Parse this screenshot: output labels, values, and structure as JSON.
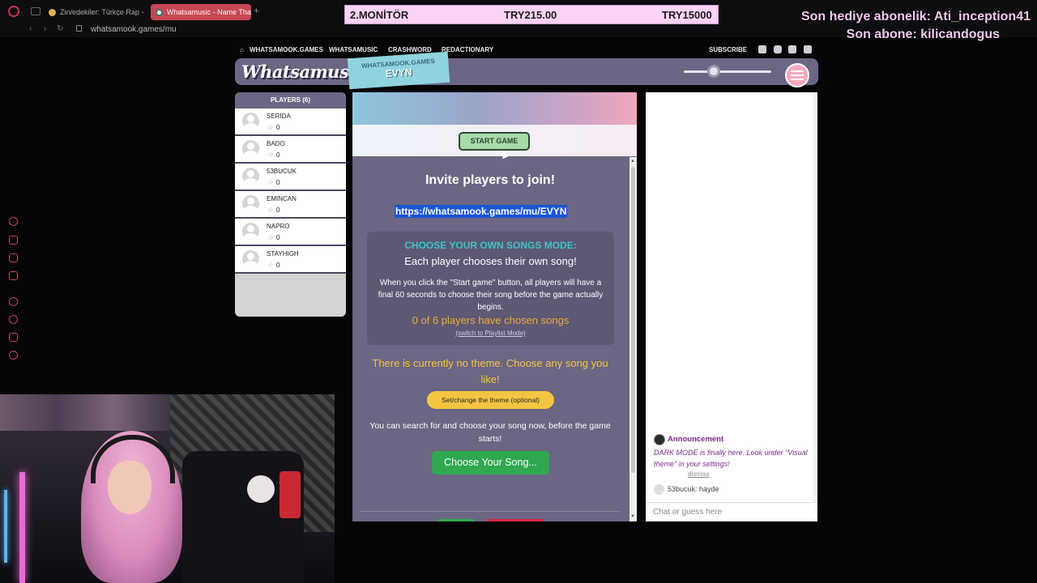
{
  "browser": {
    "tabs": [
      {
        "label": "Zirvedekiler: Türkçe Rap -",
        "active": false
      },
      {
        "label": "Whatsamusic - Name That",
        "active": true
      }
    ],
    "new_tab": "+",
    "url": "whatsamook.games/mu",
    "back": "‹",
    "forward": "›",
    "reload": "↻"
  },
  "overlay": {
    "donation_label": "2.MONİTÖR",
    "donation_current": "TRY215.00",
    "donation_goal": "TRY15000",
    "gift_sub_line": "Son hediye abonelik: Ati_inception41",
    "last_sub_line": "Son abone: kilicandogus"
  },
  "site_nav": {
    "home": "WHATSAMOOK.GAMES",
    "whatsamusic": "WHATSAMUSIC",
    "crashword": "CRASHWORD",
    "redactionary": "REDACTIONARY",
    "subscribe": "SUBSCRIBE"
  },
  "header": {
    "logo": "Whatsamusic",
    "room_host": "WHATSAMOOK.GAMES",
    "room_code": "EVYN"
  },
  "players": {
    "title": "PLAYERS (6)",
    "list": [
      {
        "name": "SERIDA",
        "score": "0"
      },
      {
        "name": "BADO",
        "score": "0"
      },
      {
        "name": "53BUCUK",
        "score": "0"
      },
      {
        "name": "EMINCAN",
        "score": "0"
      },
      {
        "name": "NAPRO",
        "score": "0"
      },
      {
        "name": "STAYHIGH",
        "score": "0"
      }
    ]
  },
  "game": {
    "start_button": "START GAME",
    "invite_heading": "Invite players to join!",
    "invite_link": "https://whatsamook.games/mu/EVYN",
    "mode_title": "CHOOSE YOUR OWN SONGS MODE:",
    "mode_subtitle": "Each player chooses their own song!",
    "mode_description": "When you click the \"Start game\" button, all players will have a final 60 seconds to choose their song before the game actually begins.",
    "songs_chosen": "0 of 6 players have chosen songs",
    "switch_mode": "(switch to Playlist Mode)",
    "theme_text": "There is currently no theme. Choose any song you like!",
    "theme_button": "Set/change the theme (optional)",
    "search_text": "You can search for and choose your song now, before the game starts!",
    "choose_button": "Choose Your Song..."
  },
  "chat": {
    "announcement_title": "Announcement",
    "announcement_body": "DARK MODE is finally here. Look under \"Visual theme\" in your settings!",
    "dismiss": "dismiss",
    "message": "53bucuk: hayde",
    "input_placeholder": "Chat or guess here"
  },
  "colors": {
    "panel": "#6b6683",
    "accent_pink": "#f4a9bf",
    "mode_title": "#3fc4c4",
    "theme_yellow": "#f4c542",
    "choose_green": "#2fa84f",
    "link_highlight": "#1a56d4"
  },
  "icons": [
    "home-icon",
    "twitter-icon",
    "instagram-icon",
    "tiktok-icon",
    "discord-icon",
    "hamburger-menu-icon",
    "star-icon",
    "avatar-icon",
    "volume-slider-knob"
  ]
}
